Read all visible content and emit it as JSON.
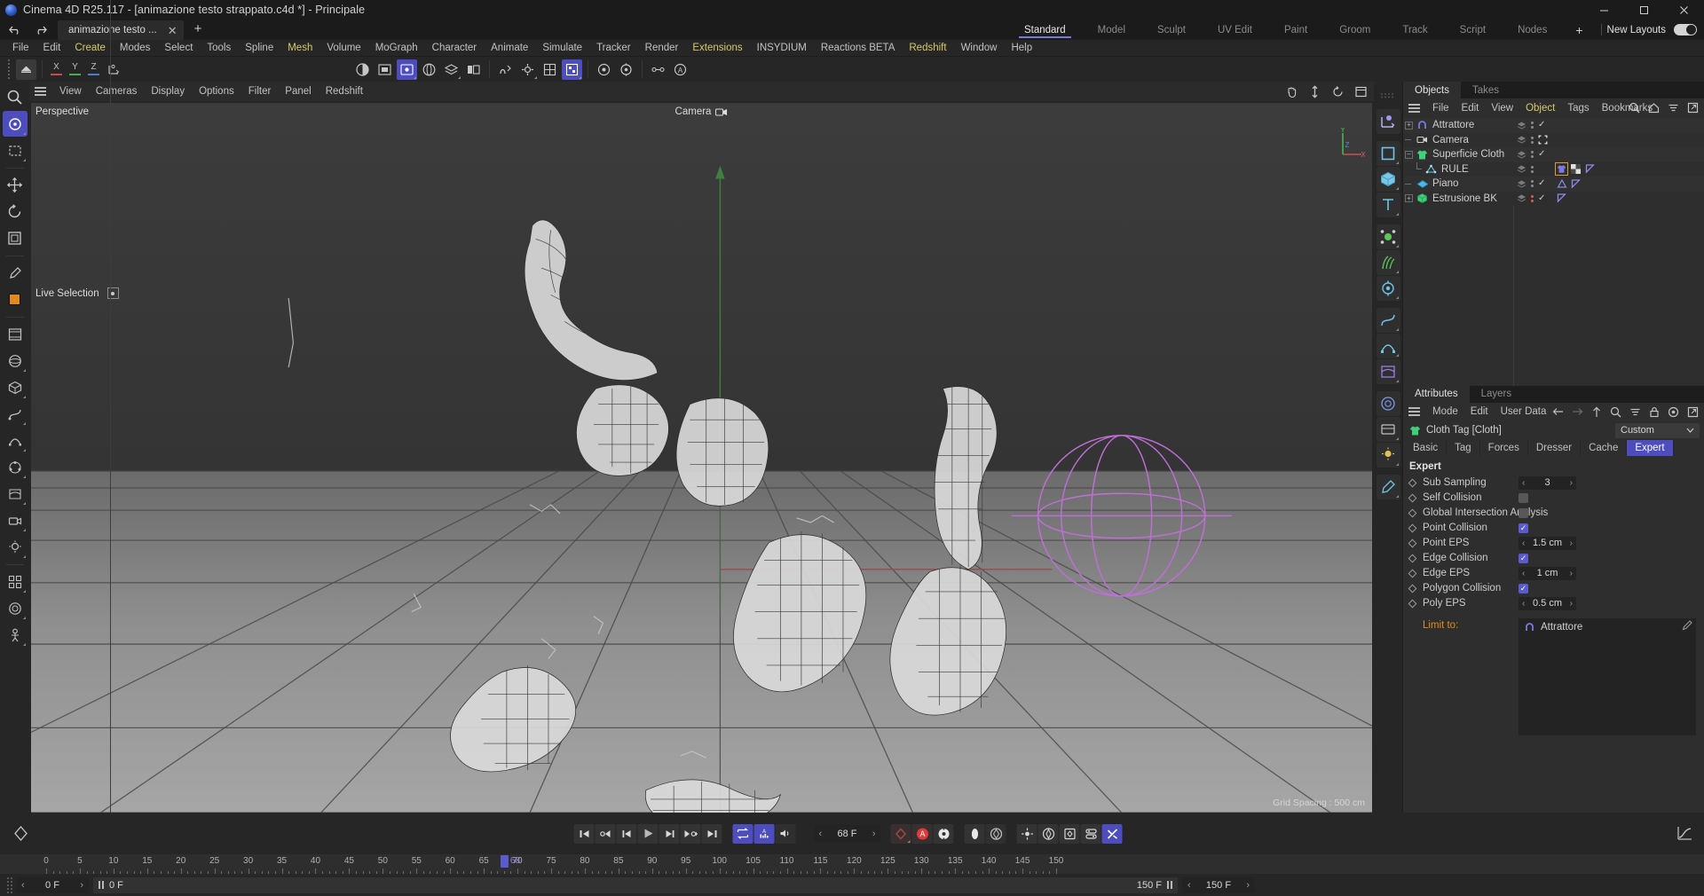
{
  "window": {
    "title": "Cinema 4D R25.117 - [animazione testo strappato.c4d *] - Principale",
    "minimize": "–",
    "maximize": "□",
    "close": "✕"
  },
  "doc_tab": {
    "label": "animazione testo ...",
    "close": "✕",
    "new": "+"
  },
  "menus": [
    "File",
    "Edit",
    "Create",
    "Modes",
    "Select",
    "Tools",
    "Spline",
    "Mesh",
    "Volume",
    "MoGraph",
    "Character",
    "Animate",
    "Simulate",
    "Tracker",
    "Render",
    "Extensions",
    "INSYDIUM",
    "Reactions BETA",
    "Redshift",
    "Window",
    "Help"
  ],
  "menus_highlighted": [
    "Create",
    "Mesh",
    "Extensions",
    "Redshift"
  ],
  "layouts": {
    "tabs": [
      "Standard",
      "Model",
      "Sculpt",
      "UV Edit",
      "Paint",
      "Groom",
      "Track",
      "Script",
      "Nodes"
    ],
    "active": "Standard",
    "plus": "+",
    "new_layouts_label": "New Layouts"
  },
  "viewport_menu": [
    "View",
    "Cameras",
    "Display",
    "Options",
    "Filter",
    "Panel",
    "Redshift"
  ],
  "viewport": {
    "perspective_label": "Perspective",
    "camera_label": "Camera",
    "live_selection": "Live Selection",
    "grid_spacing": "Grid Spacing : 500 cm",
    "axis_x": "X",
    "axis_y": "Y",
    "axis_z": "Z"
  },
  "axis_buttons": [
    {
      "label": "X",
      "color": "#c84a4a"
    },
    {
      "label": "Y",
      "color": "#4aae4a"
    },
    {
      "label": "Z",
      "color": "#4a7ec8"
    }
  ],
  "object_manager": {
    "tabs": [
      {
        "label": "Objects",
        "active": true
      },
      {
        "label": "Takes",
        "active": false
      }
    ],
    "menu": [
      "File",
      "Edit",
      "View",
      "Object",
      "Tags",
      "Bookmarks"
    ],
    "menu_highlighted": "Object",
    "items": [
      {
        "name": "Attrattore",
        "icon": "attractor-icon",
        "indent": 0,
        "expander": "+",
        "check": "✓",
        "dots": "grey",
        "tags": []
      },
      {
        "name": "Camera",
        "icon": "camera-icon",
        "indent": 0,
        "expander": "",
        "check": "",
        "dots": "grey",
        "tags": [
          "render-region-icon"
        ]
      },
      {
        "name": "Superficie Cloth",
        "icon": "cloth-icon",
        "indent": 0,
        "expander": "-",
        "check": "✓",
        "dots": "grey",
        "tags": []
      },
      {
        "name": "RULE",
        "icon": "selection-icon",
        "indent": 1,
        "expander": "",
        "check": "",
        "dots": "grey",
        "tags": [
          "cloth-tag-icon",
          "checker-tag-icon",
          "flag-tag-icon"
        ]
      },
      {
        "name": "Piano",
        "icon": "plane-icon",
        "indent": 0,
        "expander": "",
        "check": "✓",
        "dots": "grey",
        "tags": [
          "collider-tag-icon",
          "flag-tag-icon"
        ]
      },
      {
        "name": "Estrusione BK",
        "icon": "extrude-icon",
        "indent": 0,
        "expander": "+",
        "check": "✓",
        "dots": "red",
        "tags": [
          "flag-tag-icon"
        ]
      }
    ]
  },
  "attribute_manager": {
    "tabs": [
      {
        "label": "Attributes",
        "active": true
      },
      {
        "label": "Layers",
        "active": false
      }
    ],
    "menu": [
      "Mode",
      "Edit",
      "User Data"
    ],
    "object_title": "Cloth Tag [Cloth]",
    "preset_value": "Custom",
    "subtabs": [
      "Basic",
      "Tag",
      "Forces",
      "Dresser",
      "Cache",
      "Expert"
    ],
    "subtab_active": "Expert",
    "group_title": "Expert",
    "properties": [
      {
        "label": "Sub Sampling",
        "type": "number",
        "value": "3"
      },
      {
        "label": "Self Collision",
        "type": "checkbox",
        "value": false
      },
      {
        "label": "Global Intersection Analysis",
        "type": "checkbox",
        "value": false
      },
      {
        "label": "Point Collision",
        "type": "checkbox",
        "value": true
      },
      {
        "label": "Point EPS",
        "type": "number",
        "value": "1.5 cm"
      },
      {
        "label": "Edge Collision",
        "type": "checkbox",
        "value": true
      },
      {
        "label": "Edge EPS",
        "type": "number",
        "value": "1 cm"
      },
      {
        "label": "Polygon Collision",
        "type": "checkbox",
        "value": true
      },
      {
        "label": "Poly EPS",
        "type": "number",
        "value": "0.5 cm"
      }
    ],
    "limit_to_label": "Limit to:",
    "limit_to_value": "Attrattore"
  },
  "timeline": {
    "current_frame_field": "68 F",
    "playhead_label": "68",
    "ruler_ticks": [
      "0",
      "5",
      "10",
      "15",
      "20",
      "25",
      "30",
      "35",
      "40",
      "45",
      "50",
      "55",
      "60",
      "65",
      "70",
      "75",
      "80",
      "85",
      "90",
      "95",
      "100",
      "105",
      "110",
      "115",
      "120",
      "125",
      "130",
      "135",
      "140",
      "145",
      "150"
    ],
    "range_start": 0,
    "range_end": 150,
    "current_frame": 68
  },
  "statusbar": {
    "start_field": "0 F",
    "preview_start": "0 F",
    "preview_end": "150 F",
    "end_field": "150 F"
  },
  "colors": {
    "accent_blue": "#4d4dbd",
    "highlight_yellow": "#d8c96a",
    "orange_label": "#e08a1e",
    "red_dot": "#e05a5a"
  }
}
